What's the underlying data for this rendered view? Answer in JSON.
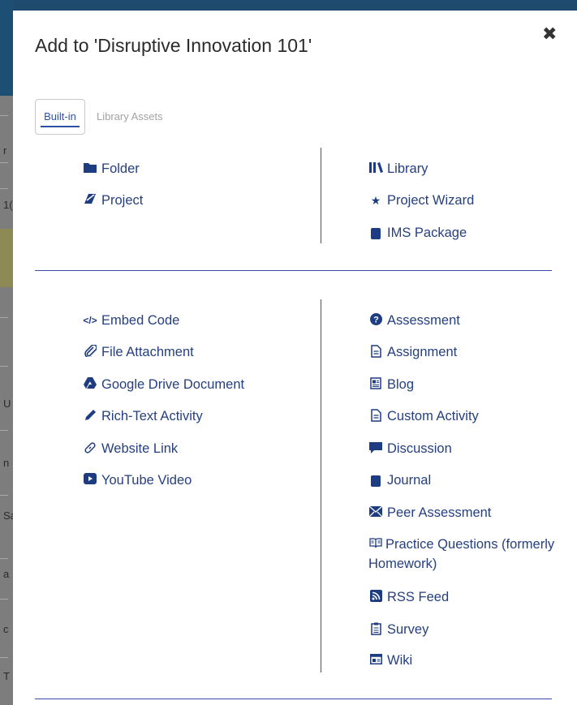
{
  "modal": {
    "title": "Add to 'Disruptive Innovation 101'",
    "close_symbol": "✖"
  },
  "tabs": [
    {
      "label": "Built-in",
      "active": true
    },
    {
      "label": "Library Assets",
      "active": false
    }
  ],
  "section1": {
    "left": [
      {
        "label": "Folder",
        "icon": "folder-icon"
      },
      {
        "label": "Project",
        "icon": "project-icon"
      }
    ],
    "right": [
      {
        "label": "Library",
        "icon": "library-icon"
      },
      {
        "label": "Project Wizard",
        "icon": "star-icon"
      },
      {
        "label": "IMS Package",
        "icon": "book-icon"
      }
    ]
  },
  "section2": {
    "left": [
      {
        "label": "Embed Code",
        "icon": "code-icon"
      },
      {
        "label": "File Attachment",
        "icon": "paperclip-icon"
      },
      {
        "label": "Google Drive Document",
        "icon": "google-drive-icon"
      },
      {
        "label": "Rich-Text Activity",
        "icon": "pencil-icon"
      },
      {
        "label": "Website Link",
        "icon": "link-icon"
      },
      {
        "label": "YouTube Video",
        "icon": "youtube-icon"
      }
    ],
    "right": [
      {
        "label": "Assessment",
        "icon": "question-circle-icon"
      },
      {
        "label": "Assignment",
        "icon": "document-icon"
      },
      {
        "label": "Blog",
        "icon": "blog-icon"
      },
      {
        "label": "Custom Activity",
        "icon": "document-icon"
      },
      {
        "label": "Discussion",
        "icon": "comment-icon"
      },
      {
        "label": "Journal",
        "icon": "journal-icon"
      },
      {
        "label": "Peer Assessment",
        "icon": "envelope-icon"
      },
      {
        "label": "Practice Questions (formerly Homework)",
        "icon": "open-book-icon"
      },
      {
        "label": "RSS Feed",
        "icon": "rss-icon"
      },
      {
        "label": "Survey",
        "icon": "clipboard-icon"
      },
      {
        "label": "Wiki",
        "icon": "wiki-icon"
      }
    ]
  },
  "background_glyphs": [
    "r",
    "1(",
    "U",
    "n",
    "Sa",
    "a",
    "c",
    "T"
  ],
  "colors": {
    "accent": "#26407e",
    "divider": "#3c4eaa",
    "topbar": "#1f4b6e"
  }
}
